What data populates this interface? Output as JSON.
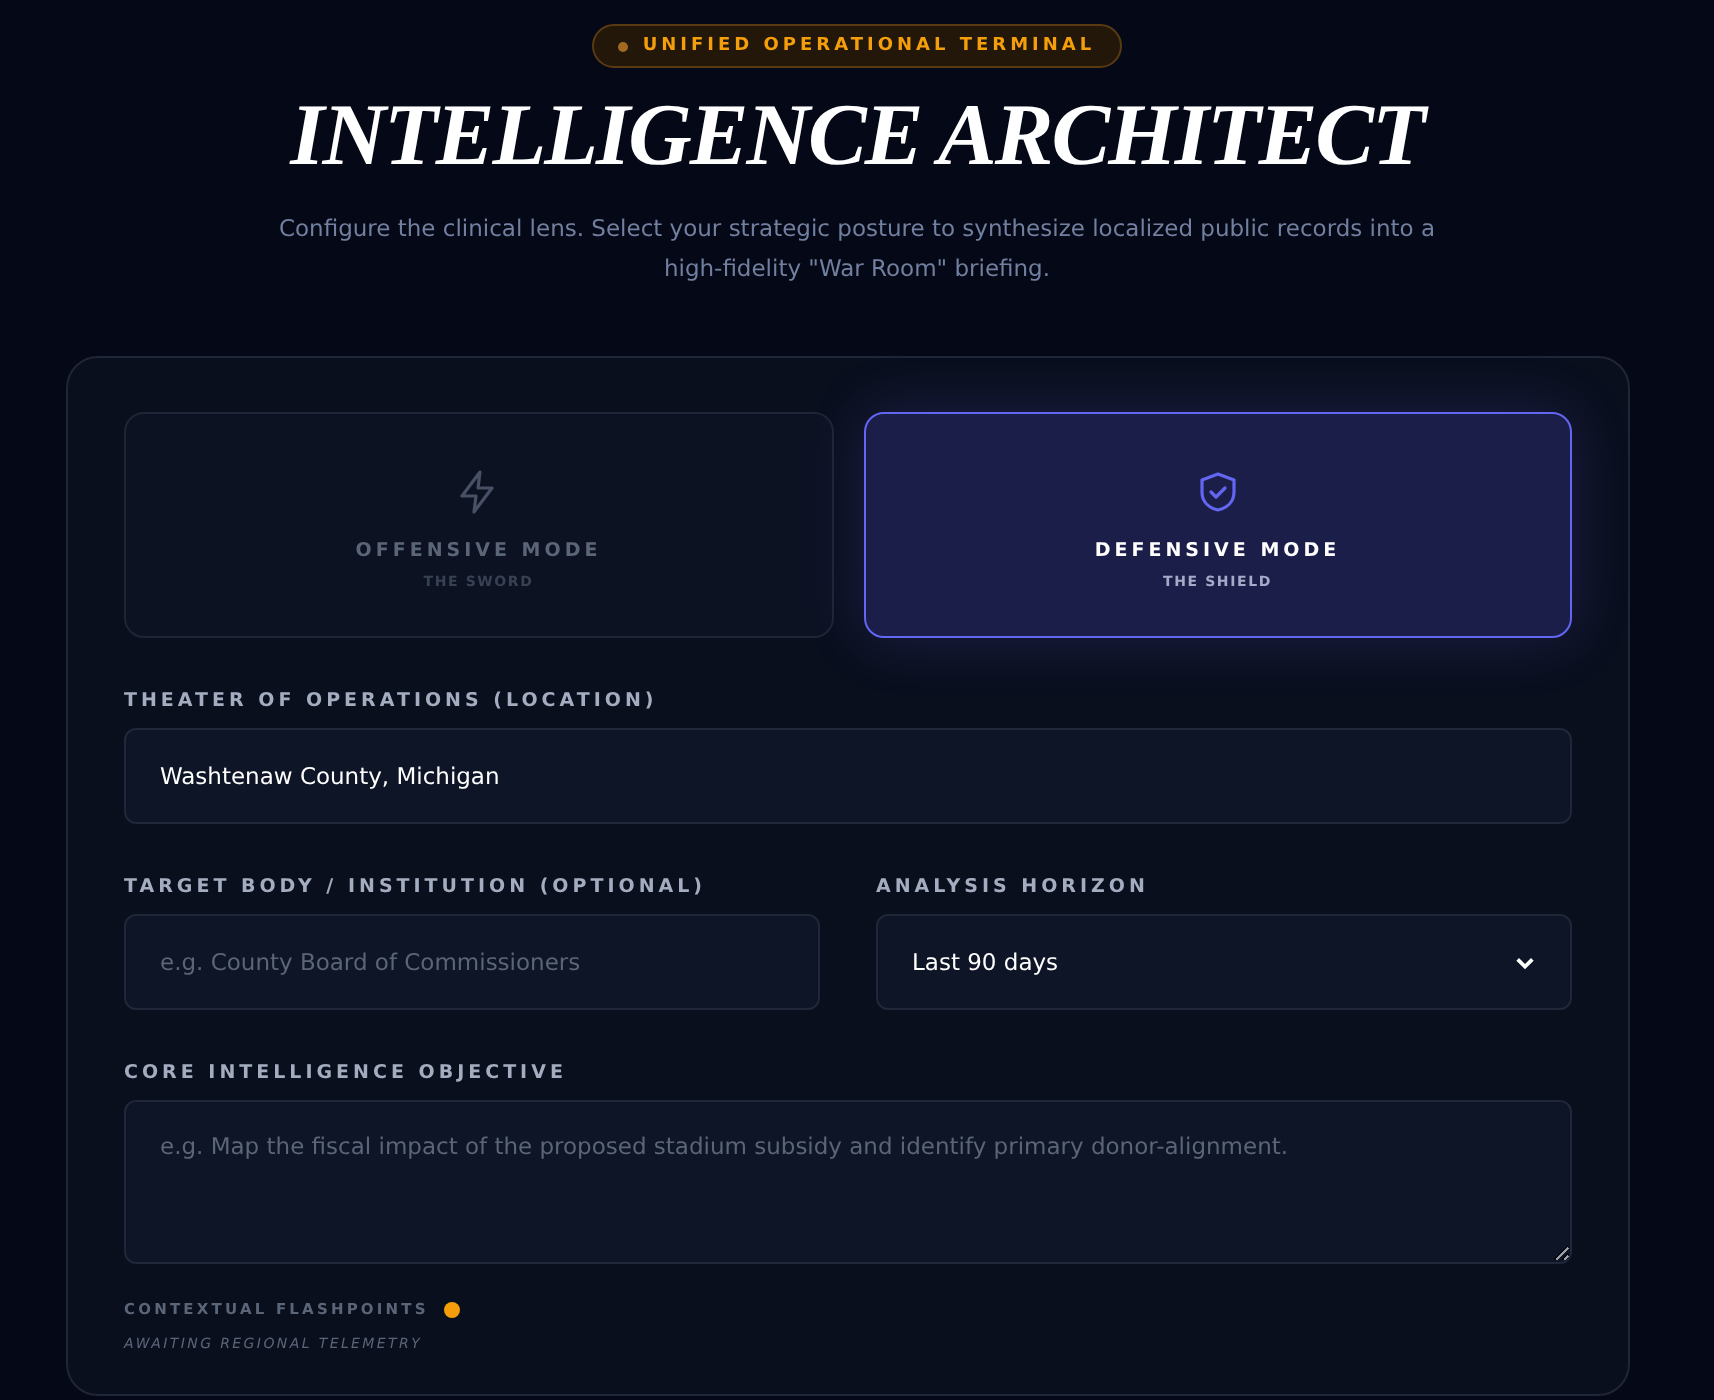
{
  "badge": {
    "text": "UNIFIED OPERATIONAL TERMINAL"
  },
  "title": "INTELLIGENCE ARCHITECT",
  "subtitle": "Configure the clinical lens. Select your strategic posture to synthesize localized public records into a high-fidelity \"War Room\" briefing.",
  "modes": [
    {
      "kind": "bolt",
      "label": "OFFENSIVE MODE",
      "caption": "THE SWORD",
      "selected": false
    },
    {
      "kind": "shield",
      "label": "DEFENSIVE MODE",
      "caption": "THE SHIELD",
      "selected": true
    }
  ],
  "location": {
    "label": "THEATER OF OPERATIONS (LOCATION)",
    "value": "Washtenaw County, Michigan"
  },
  "target": {
    "label": "TARGET BODY / INSTITUTION (OPTIONAL)",
    "placeholder": "e.g. County Board of Commissioners"
  },
  "horizon": {
    "label": "ANALYSIS HORIZON",
    "value": "Last 90 days"
  },
  "objective": {
    "label": "CORE INTELLIGENCE OBJECTIVE",
    "placeholder": "e.g. Map the fiscal impact of the proposed stadium subsidy and identify primary donor-alignment."
  },
  "flashpoints": {
    "label": "CONTEXTUAL FLASHPOINTS",
    "color": "#f59e0b",
    "status": "AWAITING REGIONAL TELEMETRY"
  }
}
